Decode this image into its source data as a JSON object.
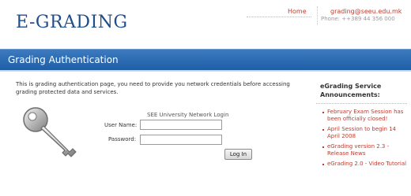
{
  "header": {
    "logo": "E-GRADING",
    "home_link": "Home",
    "email": "grading@seeu.edu.mk",
    "phone": "Phone: ++389 44 356 000"
  },
  "banner": {
    "title": "Grading Authentication"
  },
  "intro": {
    "text": "This is grading authentication page, you need to provide you network credentials before accessing grading protected data and services."
  },
  "login_form": {
    "title": "SEE University Network Login",
    "username_label": "User Name:",
    "username_value": "",
    "password_label": "Password:",
    "password_value": "",
    "submit_label": "Log In"
  },
  "announcements": {
    "title": "eGrading Service Announcements:",
    "items": [
      {
        "label": "February Exam Session has been officially closed!"
      },
      {
        "label": "April Session to begin 14 April 2008"
      },
      {
        "label": "eGrading version 2.3 - Release News"
      },
      {
        "label": "eGrading 2.0 - Video Tutorial"
      }
    ]
  },
  "icons": {
    "key": "key-icon"
  },
  "colors": {
    "brand_blue": "#1f4e8c",
    "banner_top": "#3d7ac0",
    "banner_bottom": "#1f5ea6",
    "link_red": "#c23a2c"
  }
}
